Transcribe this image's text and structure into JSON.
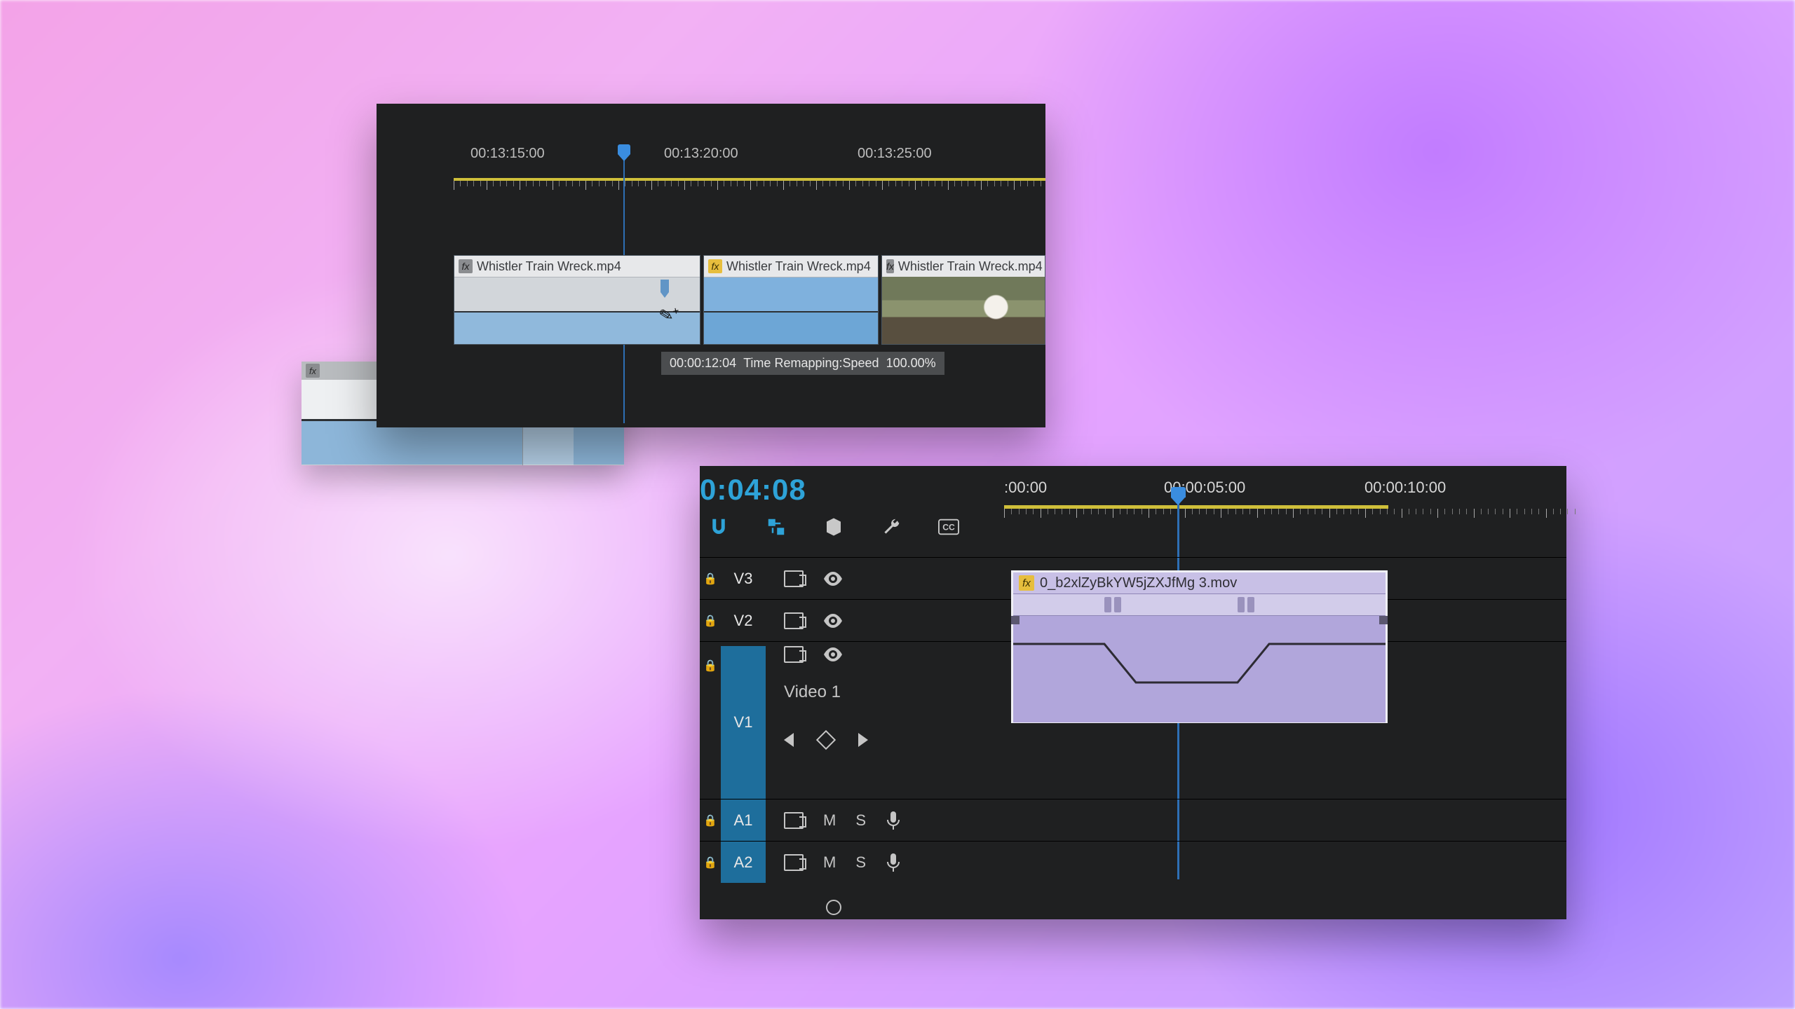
{
  "panelA": {
    "ruler": {
      "labels": [
        "00:13:15:00",
        "00:13:20:00",
        "00:13:25:00"
      ]
    },
    "clips": [
      {
        "name": "Whistler Train Wreck.mp4",
        "fx_color": "#8b8d90"
      },
      {
        "name": "Whistler Train Wreck.mp4",
        "fx_color": "#e7be3d"
      },
      {
        "name": "Whistler Train Wreck.mp4",
        "fx_color": "#8b8d90"
      }
    ],
    "tooltip": {
      "tc": "00:00:12:04",
      "label": "Time Remapping:Speed",
      "value": "100.00%"
    }
  },
  "panelB": {
    "timecode": "0:04:08",
    "ruler": {
      "labels": [
        ":00:00",
        "00:00:05:00",
        "00:00:10:00"
      ]
    },
    "tracks": {
      "video": [
        {
          "id": "V3"
        },
        {
          "id": "V2"
        },
        {
          "id": "V1",
          "name": "Video 1",
          "target": true
        }
      ],
      "audio": [
        {
          "id": "A1",
          "mute": "M",
          "solo": "S",
          "target": true
        },
        {
          "id": "A2",
          "mute": "M",
          "solo": "S",
          "target": true
        }
      ]
    },
    "clip": {
      "name": "0_b2xlZyBkYW5jZXJfMg 3.mov"
    }
  }
}
